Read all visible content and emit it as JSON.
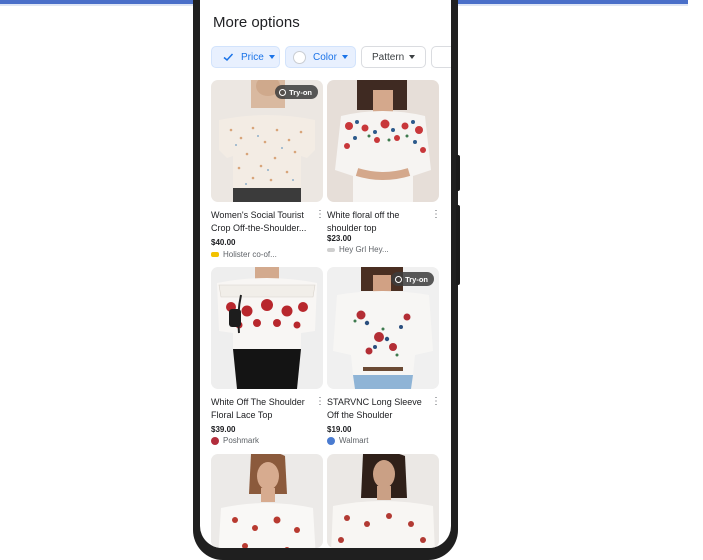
{
  "header": {
    "title": "More options"
  },
  "chips": {
    "price": "Price",
    "color": "Color",
    "pattern": "Pattern"
  },
  "badges": {
    "try_on": "Try-on"
  },
  "products": [
    {
      "name": "Women's Social Tourist Crop Off-the-Shoulder...",
      "price": "$40.00",
      "merchant": "Holister co-of...",
      "try_on": true
    },
    {
      "name": "White floral off the shoulder top",
      "price": "$23.00",
      "merchant": "Hey Grl Hey...",
      "try_on": false
    },
    {
      "name": "White Off The Shoulder Floral Lace Top",
      "price": "$39.00",
      "merchant": "Poshmark",
      "try_on": false
    },
    {
      "name": "STARVNC Long Sleeve Off the Shoulder",
      "price": "$19.00",
      "merchant": "Walmart",
      "try_on": true
    }
  ],
  "colors": {
    "accent": "#1a73e8",
    "chip_bg": "#e8f0fe",
    "text": "#202124",
    "muted": "#5f6368",
    "topbar": "#4a6fc9",
    "poshmark": "#b22d3c",
    "walmart": "#4a7bd0",
    "holister": "#f2c200"
  }
}
